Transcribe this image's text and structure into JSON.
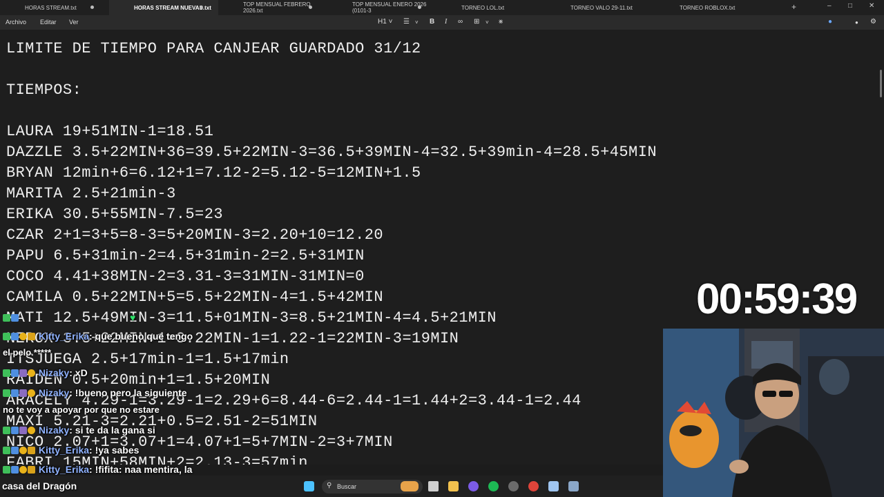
{
  "tabs": [
    {
      "label": "HORAS STREAM.txt",
      "active": false,
      "dot": true
    },
    {
      "label": "HORAS STREAM NUEVAS.txt",
      "active": true,
      "dot": true
    },
    {
      "label": "TOP MENSUAL FEBRERO 2026.txt",
      "active": false,
      "dot": true
    },
    {
      "label": "TOP MENSUAL ENERO 2026 (0101-3",
      "active": false,
      "dot": true
    },
    {
      "label": "TORNEO LOL.txt",
      "active": false,
      "dot": false
    },
    {
      "label": "TORNEO VALO 29-11.txt",
      "active": false,
      "dot": false
    },
    {
      "label": "TORNEO ROBLOX.txt",
      "active": false,
      "dot": false
    }
  ],
  "menu": {
    "file": "Archivo",
    "edit": "Editar",
    "view": "Ver"
  },
  "toolbar": {
    "heading": "H1"
  },
  "lines": [
    "LIMITE DE TIEMPO PARA CANJEAR GUARDADO 31/12",
    "",
    "TIEMPOS:",
    "",
    "LAURA 19+51MIN-1=18.51",
    "DAZZLE 3.5+22MIN+36=39.5+22MIN-3=36.5+39MIN-4=32.5+39min-4=28.5+45MIN",
    "BRYAN 12min+6=6.12+1=7.12-2=5.12-5=12MIN+1.5",
    "MARITA 2.5+21min-3",
    "ERIKA 30.5+55MIN-7.5=23",
    "CZAR 2+1=3+5=8-3=5+20MIN-3=2.20+10=12.20",
    "PAPU 6.5+31min-2=4.5+31min-2=2.5+31MIN",
    "COCO 4.41+38MIN-2=3.31-3=31MIN-31MIN=0",
    "CAMILA 0.5+22MIN+5=5.5+22MIN-4=1.5+42MIN",
    "MATI 12.5+49MIN-3=11.5+01MIN-3=8.5+21MIN-4=4.5+21MIN",
    "NEROX 3.5+22MIN+1=3.22MIN-1=1.22-1=22MIN-3=19MIN",
    "ITSJUEGA 2.5+17min-1=1.5+17min",
    "RAIDEN 0.5+20min+1=1.5+20MIN",
    "ARACELY 4.29-1=3.29-1=2.29+6=8.44-6=2.44-1=1.44+2=3.44-1=2.44",
    "MAXI 5.21-3=2.21+0.5=2.51-2=51MIN",
    "NICO 2.07+1=3.07+1=4.07+1=5+7MIN-2=3+7MIN",
    "FABRI 15MIN+58MIN+2=2.13-3=57min"
  ],
  "timer": "00:59:39",
  "chat": [
    {
      "user": "",
      "text": "",
      "extra": "♥"
    },
    {
      "user": "Kitty_Erika",
      "text": ": que bueno que tengo"
    },
    {
      "user": "",
      "text": "el pelo *****"
    },
    {
      "user": "Nizaky",
      "text": ": xD"
    },
    {
      "user": "Nizaky",
      "text": ": !bueno pero la siguiente"
    },
    {
      "user": "",
      "text": "no te voy a apoyar por que no estare"
    },
    {
      "user": "Nizaky",
      "text": ": si te da la gana si"
    },
    {
      "user": "Kitty_Erika",
      "text": ": !ya sabes"
    },
    {
      "user": "Kitty_Erika",
      "text": ": !fifita: naa mentira, la"
    },
    {
      "user": "",
      "text": "casa del Dragón"
    }
  ],
  "taskbar": {
    "search_placeholder": "Buscar"
  },
  "colors": {
    "editor_bg": "#1e1e1e",
    "nick": "#8fb2ff",
    "accent_taskbar": "#4cc2ff"
  }
}
